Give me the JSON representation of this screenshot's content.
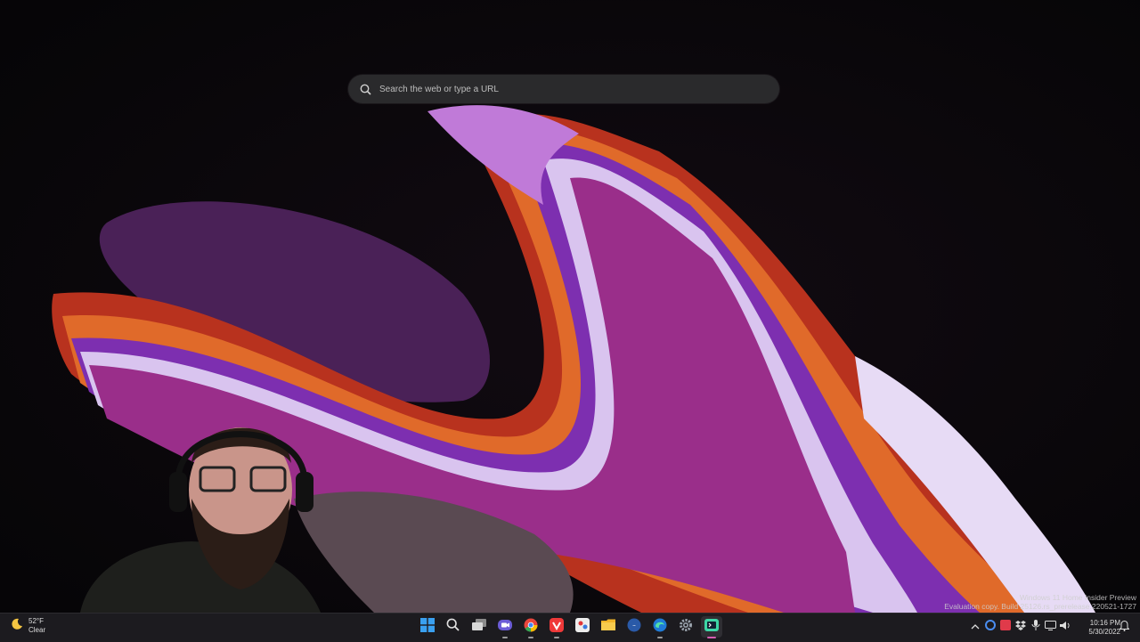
{
  "colors": {
    "taskbar_bg": "#1c1b1f",
    "accent": "#d65db1",
    "desktop_bg": "#070608"
  },
  "browser": {
    "search_placeholder": "Search the web or type a URL"
  },
  "watermark": {
    "line1": "Windows 11 Home Insider Preview",
    "line2": "Evaluation copy. Build 25126.rs_prerelease.220521-1727"
  },
  "weather": {
    "temp": "52°F",
    "condition": "Clear"
  },
  "taskbar": {
    "apps": [
      "start-icon",
      "search-icon",
      "task-view-icon",
      "chat-icon",
      "chrome-icon",
      "vivaldi-icon",
      "snipping-tool-icon",
      "file-explorer-icon",
      "app-icon",
      "edge-icon",
      "settings-icon",
      "terminal-icon"
    ],
    "active_app": "terminal-icon"
  },
  "clock": {
    "time": "10:16 PM",
    "date": "5/30/2022"
  }
}
